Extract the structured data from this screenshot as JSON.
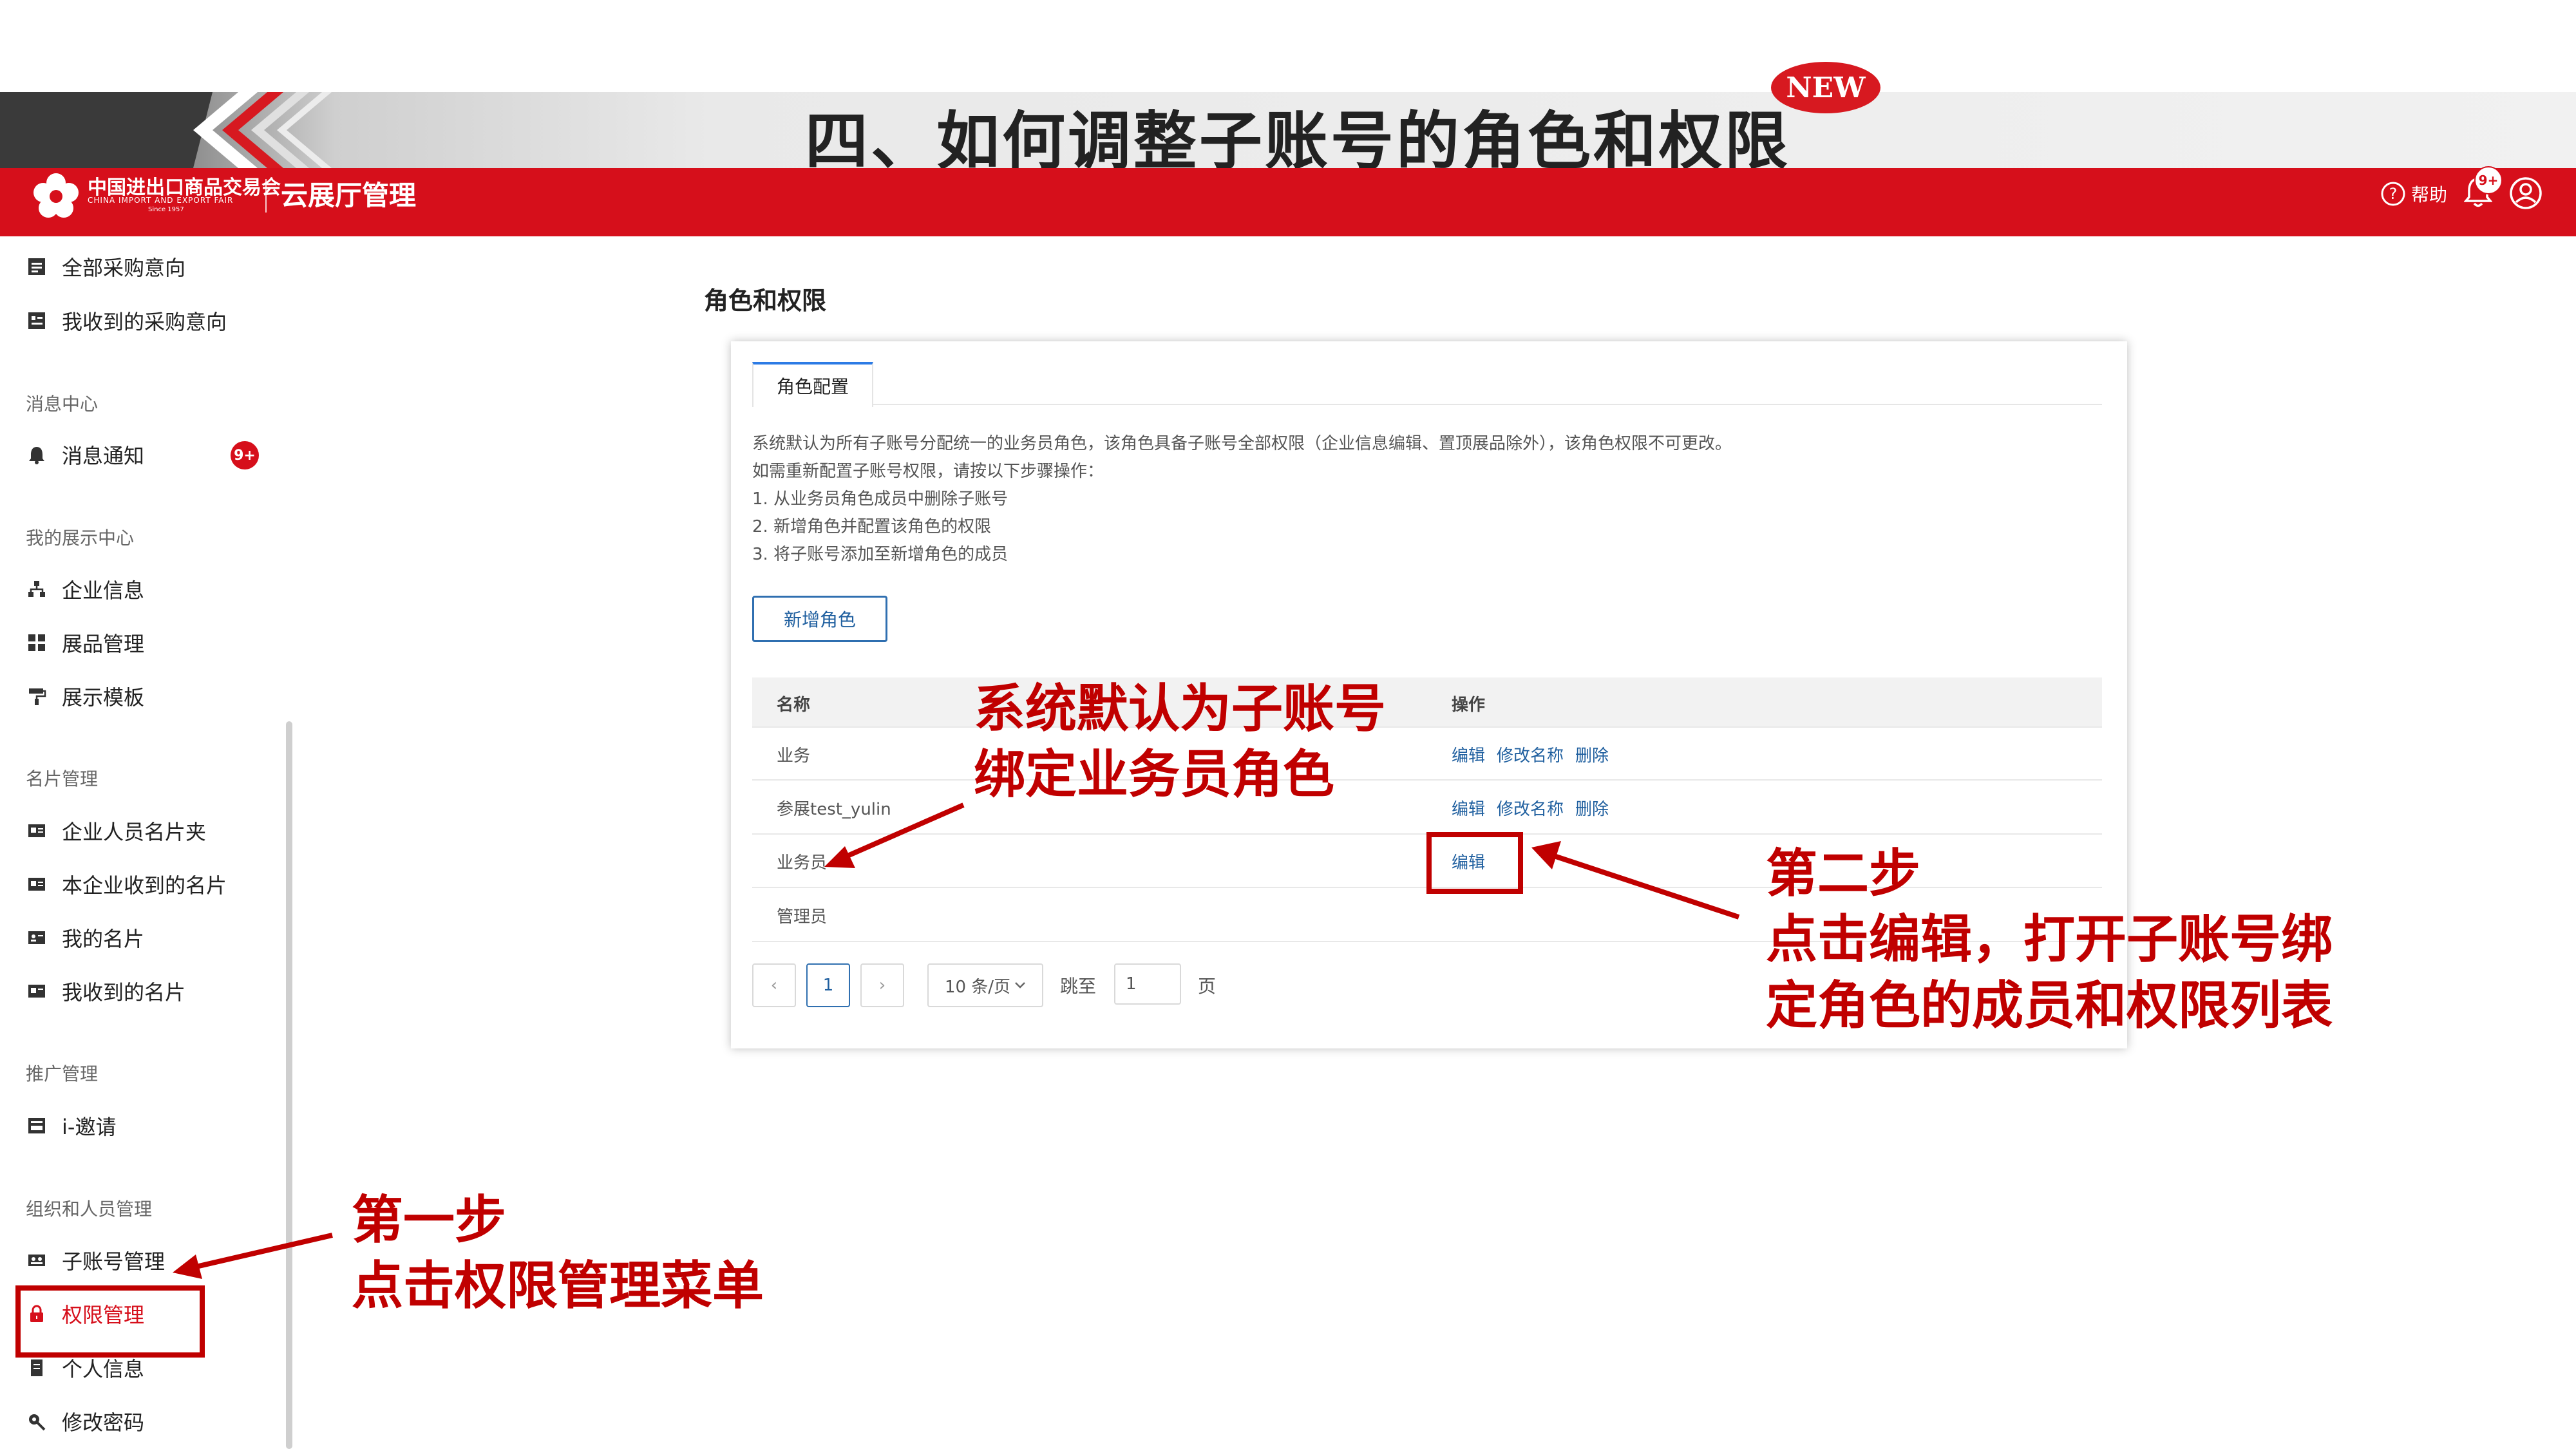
{
  "slide": {
    "title": "四、如何调整子账号的角色和权限",
    "new_badge": "NEW"
  },
  "header": {
    "logo_cn": "中国进出口商品交易会",
    "logo_en": "CHINA IMPORT AND EXPORT FAIR",
    "logo_since": "Since 1957",
    "brand_title": "云展厅管理",
    "help_label": "帮助",
    "notification_badge": "9+"
  },
  "sidebar": {
    "items_top": [
      {
        "label": "全部采购意向",
        "icon": "list-icon"
      },
      {
        "label": "我收到的采购意向",
        "icon": "inbox-list-icon"
      }
    ],
    "sections": {
      "messages": "消息中心",
      "exhibit": "我的展示中心",
      "cards": "名片管理",
      "promo": "推广管理",
      "org": "组织和人员管理"
    },
    "messages_item": {
      "label": "消息通知",
      "badge": "9+"
    },
    "exhibit_items": [
      "企业信息",
      "展品管理",
      "展示模板"
    ],
    "card_items": [
      "企业人员名片夹",
      "本企业收到的名片",
      "我的名片",
      "我收到的名片"
    ],
    "promo_items": [
      "i-邀请"
    ],
    "org_items": [
      "子账号管理",
      "权限管理",
      "个人信息",
      "修改密码"
    ],
    "active_item": "权限管理"
  },
  "main": {
    "page_title": "角色和权限",
    "tab_label": "角色配置",
    "description": [
      "系统默认为所有子账号分配统一的业务员角色，该角色具备子账号全部权限（企业信息编辑、置顶展品除外），该角色权限不可更改。",
      "如需重新配置子账号权限，请按以下步骤操作：",
      "1. 从业务员角色成员中删除子账号",
      "2. 新增角色并配置该角色的权限",
      "3. 将子账号添加至新增角色的成员"
    ],
    "add_role_button": "新增角色",
    "table": {
      "columns": [
        "名称",
        "操作"
      ],
      "rows": [
        {
          "name": "业务",
          "actions": [
            "编辑",
            "修改名称",
            "删除"
          ]
        },
        {
          "name": "参展test_yulin",
          "actions": [
            "编辑",
            "修改名称",
            "删除"
          ]
        },
        {
          "name": "业务员",
          "actions": [
            "编辑"
          ]
        },
        {
          "name": "管理员",
          "actions": []
        }
      ]
    },
    "pagination": {
      "prev": "‹",
      "current_page": "1",
      "next": "›",
      "page_size": "10 条/页",
      "jump_label": "跳至",
      "jump_value": "1",
      "page_suffix": "页"
    }
  },
  "annotations": {
    "role_note_line1": "系统默认为子账号",
    "role_note_line2": "绑定业务员角色",
    "step2_line1": "第二步",
    "step2_line2": "点击编辑，打开子账号绑",
    "step2_line3": "定角色的成员和权限列表",
    "step1_line1": "第一步",
    "step1_line2": "点击权限管理菜单"
  },
  "colors": {
    "brand_red": "#d60f1b",
    "annotation_red": "#c00000",
    "link_blue": "#1f5f9f"
  }
}
